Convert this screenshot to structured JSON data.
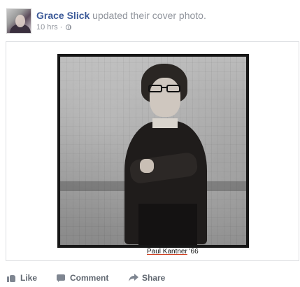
{
  "post": {
    "author": "Grace Slick",
    "action": "updated their cover photo.",
    "time": "10 hrs",
    "separator": "·",
    "privacy_icon": "globe-icon"
  },
  "photo": {
    "caption_name": "Paul Kantner",
    "caption_year": "'66"
  },
  "actions": {
    "like_label": "Like",
    "comment_label": "Comment",
    "share_label": "Share"
  },
  "colors": {
    "link_blue": "#3b5998",
    "meta_gray": "#90949c",
    "action_gray": "#606770"
  }
}
